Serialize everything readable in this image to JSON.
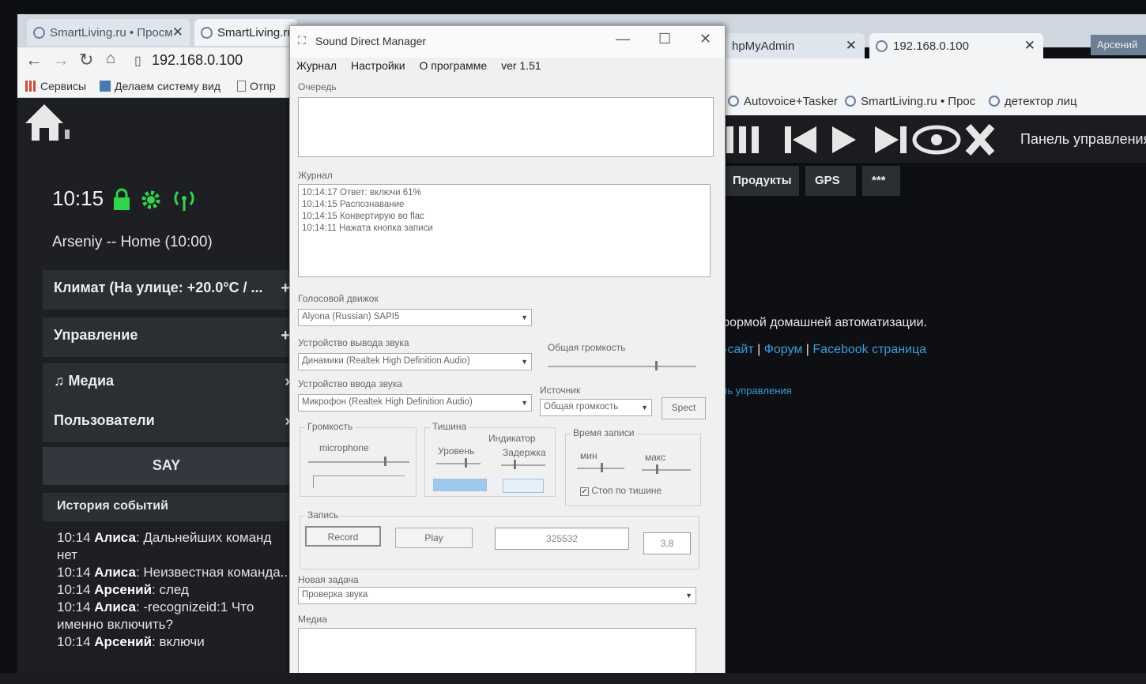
{
  "browser": {
    "tabs": [
      {
        "label": "SmartLiving.ru • Просм"
      },
      {
        "label": "SmartLiving.ru"
      }
    ],
    "right_tabs": [
      {
        "label": "hpMyAdmin"
      },
      {
        "label": "192.168.0.100"
      }
    ],
    "user_badge": "Арсений",
    "url": "192.168.0.100",
    "bookmarks": [
      "Сервисы",
      "Делаем систему вид",
      "Отпр"
    ],
    "bookmarks_right": [
      "Autovoice+Tasker",
      "SmartLiving.ru • Прос",
      "детектор лиц"
    ]
  },
  "dashboard": {
    "time": "10:15",
    "user_line": "Arseniy -- Home (10:00)",
    "menu": [
      {
        "label": "Климат (На улице: +20.0°C / ..."
      },
      {
        "label": "Управление"
      },
      {
        "label": "Медиа"
      },
      {
        "label": "Пользователи"
      }
    ],
    "say_label": "SAY",
    "history_title": "История событий",
    "history": [
      {
        "time": "10:14",
        "who": "Алиса",
        "text": ": Дальнейших команд нет"
      },
      {
        "time": "10:14",
        "who": "Алиса",
        "text": ": Неизвестная команда..."
      },
      {
        "time": "10:14",
        "who": "Арсений",
        "text": ": след"
      },
      {
        "time": "10:14",
        "who": "Алиса",
        "text": ": -recognizeid:1 Что именно включить?"
      },
      {
        "time": "10:14",
        "who": "Арсений",
        "text": ": включи"
      }
    ],
    "panel_title": "Панель управления",
    "subtabs": [
      "Продукты",
      "GPS",
      "***"
    ],
    "text_platform": "формой домашней автоматизации.",
    "link_site": "б-сайт",
    "link_forum": "Форум",
    "link_facebook": "Facebook страница",
    "link_panel": "ель управления",
    "separator": "|"
  },
  "window": {
    "title": "Sound Direct Manager",
    "menu": [
      "Журнал",
      "Настройки",
      "О программе",
      "ver 1.51"
    ],
    "queue_label": "Очередь",
    "log_label": "Журнал",
    "log": [
      "10:14:17 Ответ: включи 61%",
      "10:14:15 Распознавание",
      "10:14:15 Конвертирую во flac",
      "10:14:11 Нажата кнопка записи"
    ],
    "engine_label": "Голосовой движок",
    "engine_value": "Alyona (Russian) SAPI5",
    "output_label": "Устройство вывода звука",
    "output_value": "Динамики (Realtek High Definition Audio)",
    "input_label": "Устройство ввода звука",
    "input_value": "Микрофон (Realtek High Definition Audio)",
    "master_volume_label": "Общая громкость",
    "source_label": "Источник",
    "source_value": "Общая громкость",
    "spect_label": "Spect",
    "volume_group": "Громкость",
    "microphone_label": "microphone",
    "silence_group": "Тишина",
    "level_label": "Уровень",
    "indicator_label": "Индикатор",
    "delay_label": "Задержка",
    "rec_time_group": "Время записи",
    "min_label": "мин",
    "max_label": "макс",
    "stop_on_silence": "Стоп по тишине",
    "record_group": "Запись",
    "record_btn": "Record",
    "play_btn": "Play",
    "counter": "325532",
    "duration": "3,8",
    "new_task_label": "Новая задача",
    "new_task_value": "Проверка звука",
    "media_label": "Медиа"
  }
}
